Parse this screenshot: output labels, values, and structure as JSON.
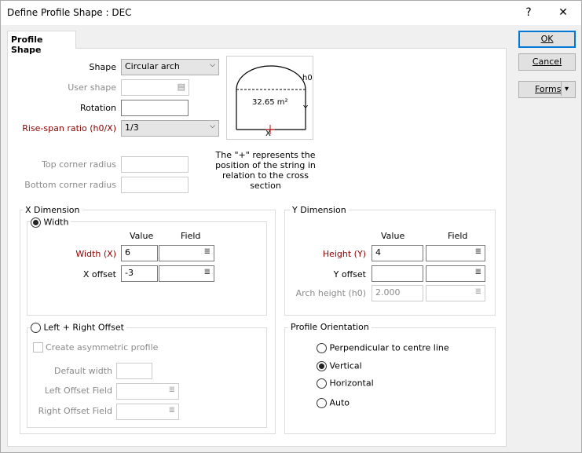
{
  "window": {
    "title": "Define Profile Shape : DEC",
    "help_glyph": "?",
    "close_glyph": "✕"
  },
  "tab": {
    "label": "Profile Shape"
  },
  "buttons": {
    "ok": "OK",
    "cancel": "Cancel",
    "forms": "Forms",
    "forms_arrow": "▾"
  },
  "shape_section": {
    "shape_label": "Shape",
    "shape_value": "Circular arch",
    "user_shape_label": "User shape",
    "user_shape_value": "",
    "rotation_label": "Rotation",
    "rotation_value": "",
    "rise_span_label": "Rise-span ratio (h0/X)",
    "rise_span_value": "1/3",
    "top_corner_label": "Top corner radius",
    "top_corner_value": "",
    "bottom_corner_label": "Bottom corner radius",
    "bottom_corner_value": ""
  },
  "diagram": {
    "area": "32.65 m²",
    "h0_label": "h0",
    "y_label": "Y",
    "x_label": "X",
    "note_line1": "The \"+\" represents the",
    "note_line2": "position of the string in",
    "note_line3": "relation to the cross section"
  },
  "x_dimension": {
    "legend": "X Dimension",
    "width_radio": "Width",
    "value_header": "Value",
    "field_header": "Field",
    "width_label": "Width (X)",
    "width_value": "6",
    "xoffset_label": "X offset",
    "xoffset_value": "-3",
    "left_right_radio": "Left + Right Offset",
    "asym_label": "Create asymmetric profile",
    "default_width_label": "Default width",
    "left_offset_label": "Left Offset Field",
    "right_offset_label": "Right Offset Field"
  },
  "y_dimension": {
    "legend": "Y Dimension",
    "value_header": "Value",
    "field_header": "Field",
    "height_label": "Height (Y)",
    "height_value": "4",
    "yoffset_label": "Y offset",
    "yoffset_value": "",
    "arch_label": "Arch height (h0)",
    "arch_value": "2.000"
  },
  "orientation": {
    "legend": "Profile Orientation",
    "options": [
      "Perpendicular to centre line",
      "Vertical",
      "Horizontal",
      "Auto"
    ],
    "selected": "Vertical"
  },
  "glyphs": {
    "combo_arrow": "⌵",
    "field_menu": "≣",
    "user_shape_icon": "▤"
  }
}
